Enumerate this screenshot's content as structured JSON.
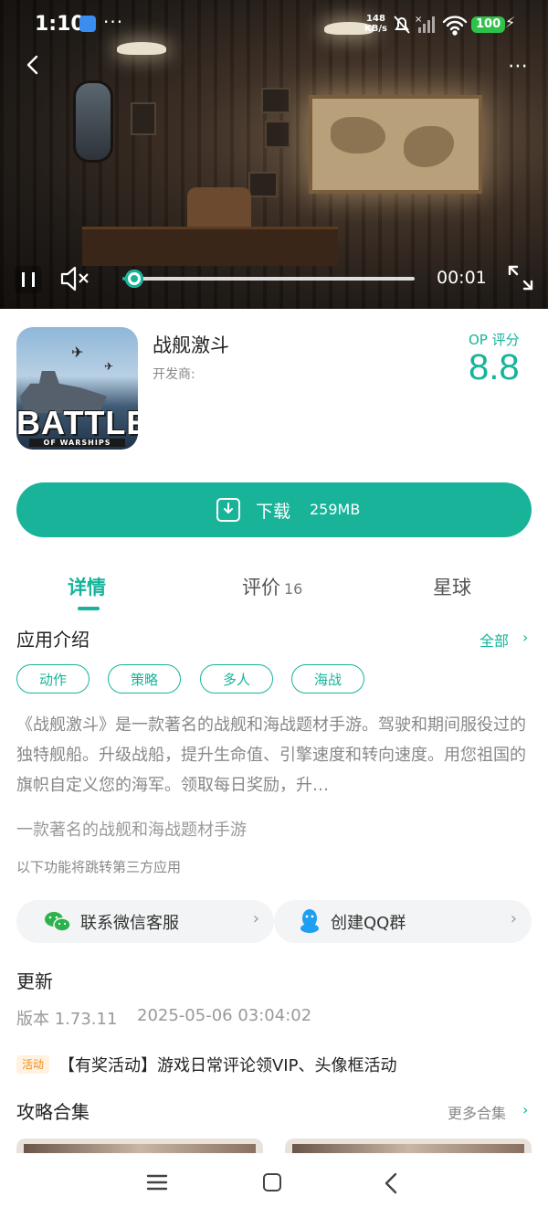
{
  "status_bar": {
    "time": "1:10",
    "dots": "···",
    "net_speed_value": "148",
    "net_speed_unit": "KB/s",
    "battery": "100"
  },
  "video": {
    "elapsed": "00:01",
    "progress": 0.04
  },
  "app": {
    "name": "战舰激斗",
    "developer_label": "开发商:",
    "score_label": "OP 评分",
    "score": "8.8",
    "icon_text": "BATTLE",
    "icon_subtext": "OF WARSHIPS"
  },
  "download": {
    "label": "下载",
    "size": "259MB"
  },
  "tabs": [
    {
      "label": "详情"
    },
    {
      "label": "评价",
      "count": "16"
    },
    {
      "label": "星球"
    }
  ],
  "intro": {
    "title": "应用介绍",
    "all_label": "全部",
    "tags": [
      "动作",
      "策略",
      "多人",
      "海战"
    ],
    "description": "《战舰激斗》是一款著名的战舰和海战题材手游。驾驶和期间服役过的独特舰船。升级战船，提升生命值、引擎速度和转向速度。用您祖国的旗帜自定义您的海军。领取每日奖励，升…",
    "tagline": "一款著名的战舰和海战题材手游",
    "third_party_note": "以下功能将跳转第三方应用"
  },
  "services": {
    "wechat": "联系微信客服",
    "qq": "创建QQ群"
  },
  "update": {
    "title": "更新",
    "version": "版本 1.73.11",
    "date": "2025-05-06 03:04:02",
    "activity_badge": "活动",
    "activity_text": "【有奖活动】游戏日常评论领VIP、头像框活动"
  },
  "guides": {
    "title": "攻略合集",
    "more_label": "更多合集"
  },
  "colors": {
    "accent": "#16b49a",
    "badge_orange": "#f08a1e"
  }
}
